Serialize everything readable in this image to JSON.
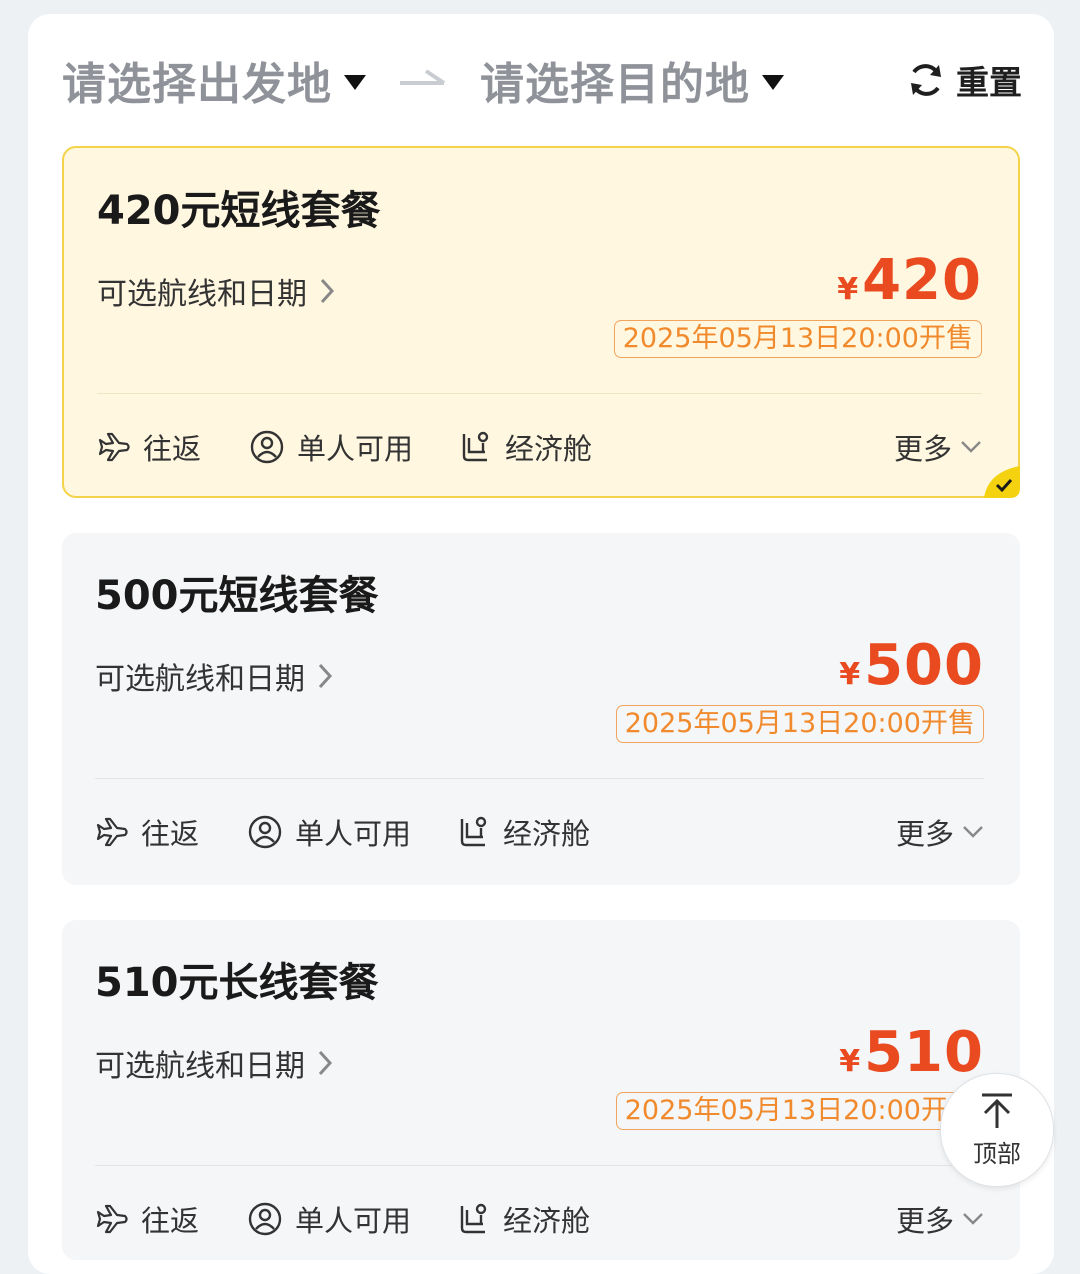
{
  "header": {
    "from_placeholder": "请选择出发地",
    "to_placeholder": "请选择目的地",
    "reset_label": "重置"
  },
  "packages": [
    {
      "title": "420元短线套餐",
      "route_link": "可选航线和日期",
      "currency": "¥",
      "price": "420",
      "sale_time": "2025年05月13日20:00开售",
      "features": [
        "往返",
        "单人可用",
        "经济舱"
      ],
      "more_label": "更多",
      "selected": true
    },
    {
      "title": "500元短线套餐",
      "route_link": "可选航线和日期",
      "currency": "¥",
      "price": "500",
      "sale_time": "2025年05月13日20:00开售",
      "features": [
        "往返",
        "单人可用",
        "经济舱"
      ],
      "more_label": "更多",
      "selected": false
    },
    {
      "title": "510元长线套餐",
      "route_link": "可选航线和日期",
      "currency": "¥",
      "price": "510",
      "sale_time": "2025年05月13日20:00开售",
      "features": [
        "往返",
        "单人可用",
        "经济舱"
      ],
      "more_label": "更多",
      "selected": false
    }
  ],
  "back_to_top_label": "顶部",
  "colors": {
    "price": "#ea4a1f",
    "sale_tag": "#f08a2c",
    "selected_bg": "#fff7e0",
    "selected_border": "#f5d348"
  }
}
